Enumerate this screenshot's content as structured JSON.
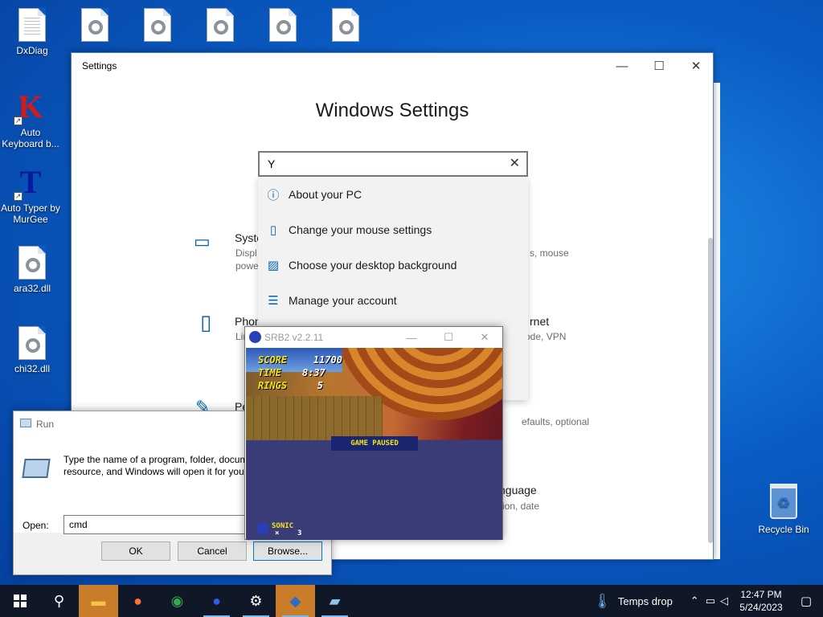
{
  "desktop": {
    "icons": [
      {
        "label": "DxDiag",
        "icon": "document-icon"
      },
      {
        "label": "",
        "icon": "dll-file-icon"
      },
      {
        "label": "",
        "icon": "dll-file-icon"
      },
      {
        "label": "",
        "icon": "dll-file-icon"
      },
      {
        "label": "",
        "icon": "dll-file-icon"
      },
      {
        "label": "",
        "icon": "dll-file-icon"
      },
      {
        "label": "Auto Keyboard b...",
        "icon": "auto-keyboard-icon",
        "glyph": "K"
      },
      {
        "label": "Auto Typer by MurGee",
        "icon": "auto-typer-icon",
        "glyph": "T"
      },
      {
        "label": "ara32.dll",
        "icon": "dll-file-icon"
      },
      {
        "label": "chi32.dll",
        "icon": "dll-file-icon"
      }
    ],
    "recycle_bin": {
      "label": "Recycle Bin",
      "icon": "recycle-bin-icon"
    }
  },
  "settings": {
    "window_title": "Settings",
    "heading": "Windows Settings",
    "search": {
      "value": "Y",
      "clear": "✕"
    },
    "suggestions": [
      {
        "label": "About your PC",
        "icon": "info-icon",
        "glyph": "ⓘ"
      },
      {
        "label": "Change your mouse settings",
        "icon": "mouse-icon",
        "glyph": "▯"
      },
      {
        "label": "Choose your desktop background",
        "icon": "image-icon",
        "glyph": "▨"
      },
      {
        "label": "Manage your account",
        "icon": "account-icon",
        "glyph": "☰"
      }
    ],
    "categories": {
      "system": {
        "title": "Syste",
        "sub1": "Displ",
        "sub2": "powe",
        "sub_right": "s, mouse"
      },
      "phone": {
        "title": "Phon",
        "sub1": "Lir"
      },
      "network": {
        "title": "rnet",
        "sub1": "ode, VPN"
      },
      "personalization": {
        "title": "Pe"
      },
      "apps": {
        "sub1": "efaults, optional"
      },
      "language": {
        "title": "nguage",
        "sub1": "ion, date"
      }
    }
  },
  "run_dialog": {
    "title": "Run",
    "description": "Type the name of a program, folder, document, or Internet resource, and Windows will open it for you.",
    "open_label": "Open:",
    "input_value": "cmd",
    "buttons": {
      "ok": "OK",
      "cancel": "Cancel",
      "browse": "Browse..."
    }
  },
  "game": {
    "window_title": "SRB2 v2.2.11",
    "hud": {
      "score_label": "SCORE",
      "score": "11700",
      "time_label": "TIME",
      "time": "8:37",
      "rings_label": "RINGS",
      "rings": "5"
    },
    "paused_text": "GAME PAUSED",
    "lives_name": "SONIC",
    "lives_x": "×",
    "lives_count": "3"
  },
  "taskbar": {
    "weather": "Temps drop",
    "time": "12:47 PM",
    "date": "5/24/2023",
    "apps": [
      {
        "icon": "search-icon",
        "glyph": "⚲"
      },
      {
        "icon": "file-explorer-icon",
        "glyph": "▬"
      },
      {
        "icon": "firefox-icon",
        "glyph": "●"
      },
      {
        "icon": "chrome-icon",
        "glyph": "◉"
      },
      {
        "icon": "srb2-icon",
        "glyph": "●"
      },
      {
        "icon": "settings-icon",
        "glyph": "⚙"
      },
      {
        "icon": "auto-typer-taskbar-icon",
        "glyph": "◆"
      },
      {
        "icon": "run-icon",
        "glyph": "▰"
      }
    ]
  }
}
